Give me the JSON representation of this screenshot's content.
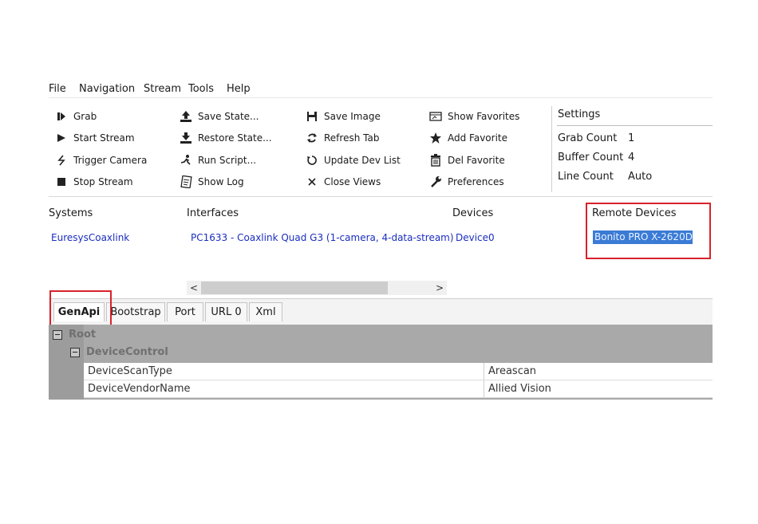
{
  "menu": [
    "File",
    "Navigation",
    "Stream",
    "Tools",
    "Help"
  ],
  "toolbar": {
    "col1": [
      "Grab",
      "Start Stream",
      "Trigger Camera",
      "Stop Stream"
    ],
    "col2": [
      "Save State...",
      "Restore State...",
      "Run Script...",
      "Show Log"
    ],
    "col3": [
      "Save Image",
      "Refresh Tab",
      "Update Dev List",
      "Close Views"
    ],
    "col4": [
      "Show Favorites",
      "Add Favorite",
      "Del Favorite",
      "Preferences"
    ]
  },
  "settings": {
    "title": "Settings",
    "grab_count_label": "Grab Count",
    "grab_count_value": "1",
    "buffer_count_label": "Buffer Count",
    "buffer_count_value": "4",
    "line_count_label": "Line Count",
    "line_count_value": "Auto"
  },
  "columns": {
    "systems": "Systems",
    "interfaces": "Interfaces",
    "devices": "Devices",
    "remote_devices": "Remote Devices"
  },
  "entries": {
    "system": "EuresysCoaxlink",
    "interface": "PC1633 - Coaxlink Quad G3 (1-camera, 4-data-stream)",
    "device": "Device0",
    "remote_device": "Bonito PRO X-2620D"
  },
  "tabs": [
    "GenApi",
    "Bootstrap",
    "Port",
    "URL 0",
    "Xml"
  ],
  "tree": {
    "root": "Root",
    "group": "DeviceControl",
    "rows": [
      {
        "key": "DeviceScanType",
        "value": "Areascan"
      },
      {
        "key": "DeviceVendorName",
        "value": "Allied Vision"
      }
    ]
  },
  "colors": {
    "highlight": "#d9222a",
    "link": "#1a2dbf",
    "selection": "#3a7bd5"
  }
}
